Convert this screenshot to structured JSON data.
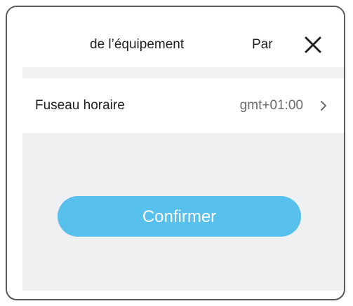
{
  "header": {
    "tab_device": "de l’équipement",
    "tab_other": "Par"
  },
  "settings": {
    "timezone": {
      "label": "Fuseau horaire",
      "value": "gmt+01:00"
    }
  },
  "actions": {
    "confirm_label": "Confirmer"
  },
  "colors": {
    "accent": "#58c0ec",
    "background_gray": "#eff0f2",
    "text": "#222222",
    "frame_border": "#58595b"
  },
  "icons": {
    "close": "close-icon",
    "chevron": "chevron-right-icon"
  }
}
